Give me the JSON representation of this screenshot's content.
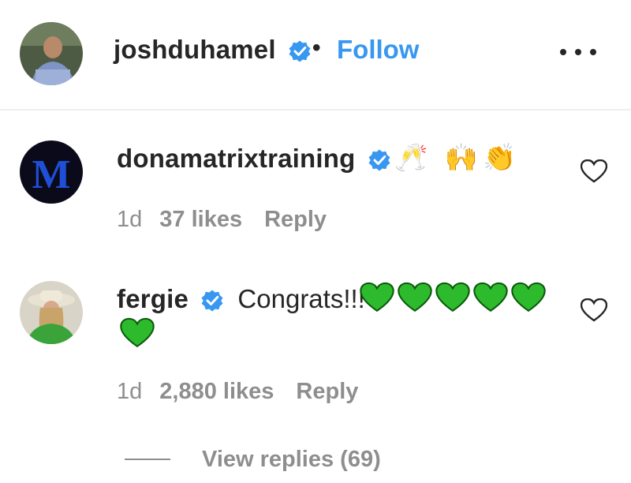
{
  "header": {
    "username": "joshduhamel",
    "separator": "•",
    "follow_label": "Follow",
    "more_icon": "more-horizontal-icon"
  },
  "comments": [
    {
      "username": "donamatrixtraining",
      "text": "",
      "emoji": "🥂 🙌👏",
      "time": "1d",
      "likes": "37 likes",
      "reply_label": "Reply"
    },
    {
      "username": "fergie",
      "text": "Congrats!!!",
      "green_hearts": 6,
      "time": "1d",
      "likes": "2,880 likes",
      "reply_label": "Reply",
      "view_replies": "View replies (69)"
    }
  ],
  "colors": {
    "link": "#3897f0",
    "verified": "#3897f0",
    "muted": "#8e8e8e",
    "text": "#262626",
    "green_heart": "#2dbb2d"
  }
}
